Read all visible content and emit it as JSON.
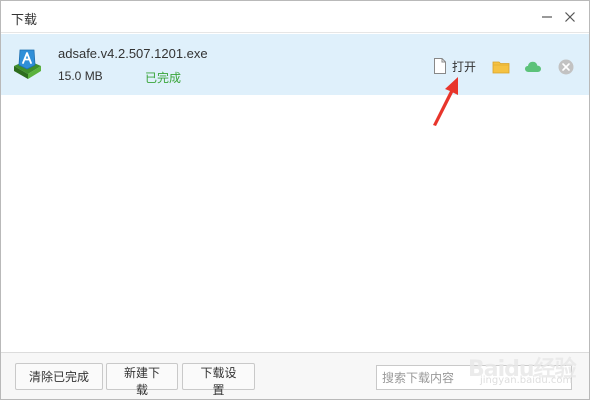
{
  "window": {
    "title": "下载"
  },
  "icons": {
    "minimize": "minimize-icon",
    "close": "close-icon",
    "file": "adsafe-app-icon",
    "open": "document-icon",
    "folder": "folder-icon",
    "cloud": "cloud-icon",
    "remove": "remove-circle-icon"
  },
  "downloads": [
    {
      "file_name": "adsafe.v4.2.507.1201.exe",
      "size": "15.0 MB",
      "status": "已完成",
      "open_label": "打开"
    }
  ],
  "footer": {
    "clear_completed_label": "清除已完成",
    "new_download_label": "新建下载",
    "settings_label": "下载设置",
    "search_placeholder": "搜索下载内容"
  },
  "watermark": {
    "brand": "Baidu经验",
    "url": "jingyan.baidu.com"
  },
  "colors": {
    "selected_row": "#dff0fb",
    "status_done": "#3aa53a",
    "folder": "#f5c242",
    "cloud": "#5cc27a",
    "annotation_arrow": "#e8352b"
  }
}
